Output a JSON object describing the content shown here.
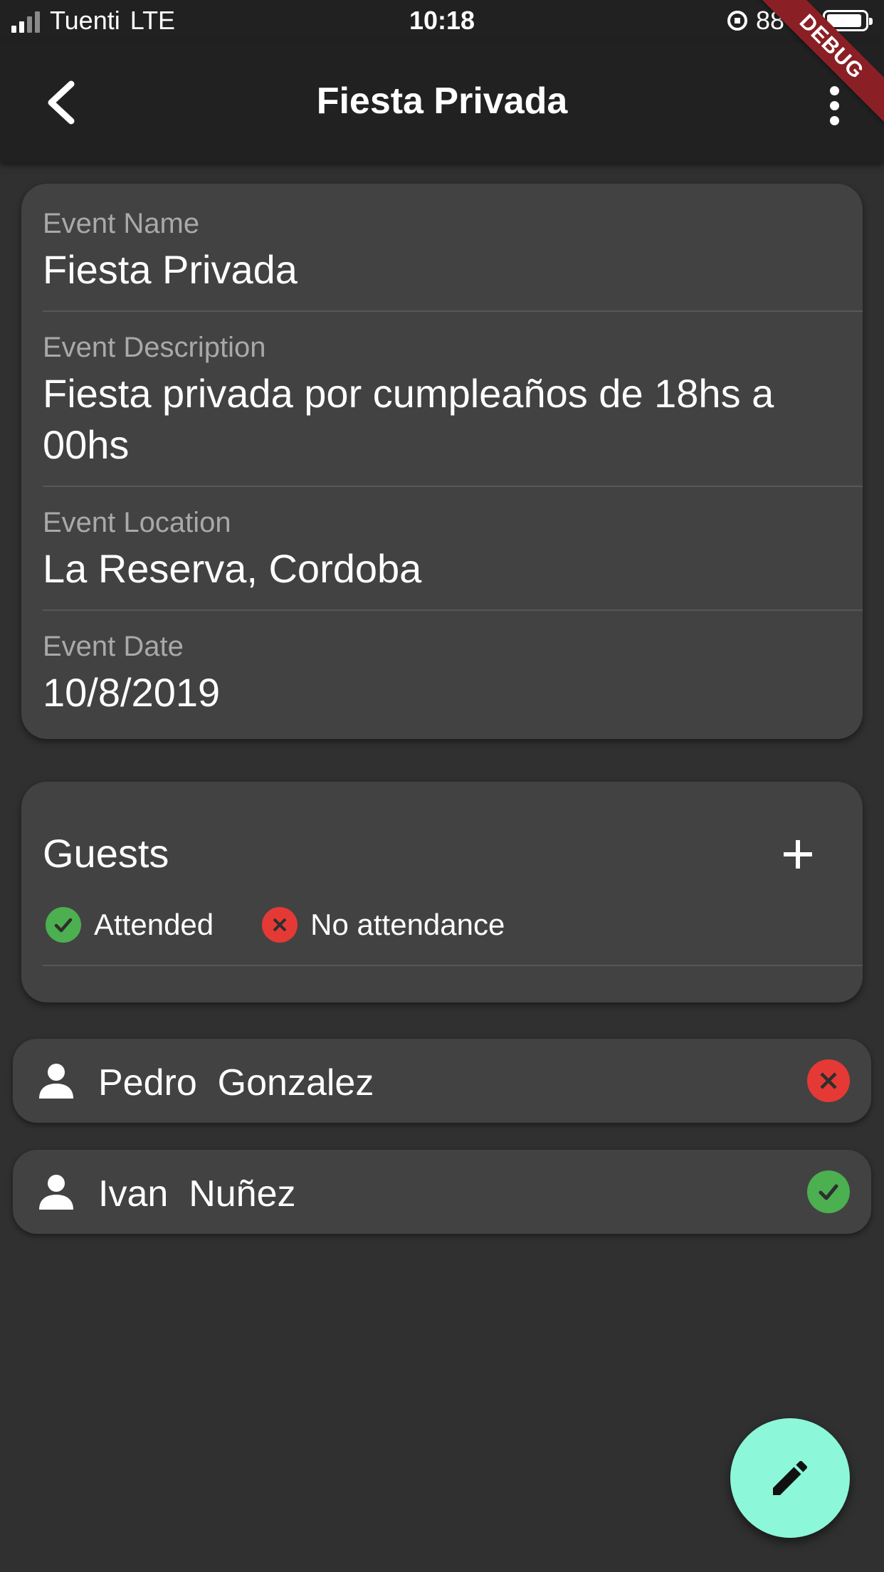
{
  "status_bar": {
    "carrier": "Tuenti",
    "network": "LTE",
    "time": "10:18",
    "battery": "88 %"
  },
  "app_bar": {
    "title": "Fiesta Privada",
    "back_icon": "back-arrow-icon",
    "menu_icon": "more-vert-icon",
    "debug_banner": "DEBUG"
  },
  "event": {
    "name_label": "Event Name",
    "name_value": "Fiesta Privada",
    "description_label": "Event Description",
    "description_value": "Fiesta privada por cumpleaños de 18hs a 00hs",
    "location_label": "Event Location",
    "location_value": "La Reserva, Cordoba",
    "date_label": "Event Date",
    "date_value": "10/8/2019"
  },
  "guests": {
    "title": "Guests",
    "add_icon": "add-icon",
    "legend": {
      "attended": "Attended",
      "no_attendance": "No attendance"
    },
    "list": [
      {
        "first_name": "Pedro",
        "last_name": "Gonzalez",
        "attended": false
      },
      {
        "first_name": "Ivan",
        "last_name": "Nuñez",
        "attended": true
      }
    ]
  },
  "fab": {
    "icon": "edit-icon"
  },
  "colors": {
    "background": "#303030",
    "app_bar": "#212121",
    "card": "#424242",
    "attended": "#4caf50",
    "no_attendance": "#e53935",
    "fab": "#8cf7d9"
  }
}
